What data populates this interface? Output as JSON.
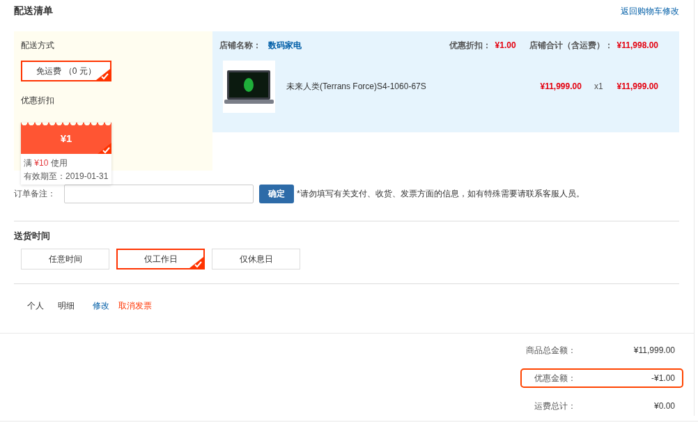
{
  "header": {
    "title": "配送清单",
    "back_link": "返回购物车修改"
  },
  "shipping": {
    "title": "配送方式",
    "options": [
      {
        "label": "免运费 （0 元）",
        "selected": true
      }
    ]
  },
  "discount": {
    "title": "优惠折扣",
    "coupons": [
      {
        "amount": "¥1",
        "condition": "满 **¥10** 使用",
        "expiry": "有效期至：2019-01-31",
        "selected": true
      }
    ]
  },
  "store": {
    "name_label": "店铺名称：",
    "name": "数码家电",
    "discount_label": "优惠折扣：",
    "discount": "¥1.00",
    "total_label": "店铺合计（含运费）：",
    "total": "¥11,998.00",
    "items": [
      {
        "name": "未来人类(Terrans Force)S4-1060-67S",
        "price": "¥11,999.00",
        "quantity": "x1",
        "subtotal": "¥11,999.00"
      }
    ]
  },
  "remark": {
    "label": "订单备注：",
    "button": "确定",
    "note": "*请勿填写有关支付、收货、发票方面的信息，如有特殊需要请联系客服人员。"
  },
  "delivery_time": {
    "title": "送货时间",
    "options": [
      {
        "label": "任意时间",
        "selected": false
      },
      {
        "label": "仅工作日",
        "selected": true
      },
      {
        "label": "仅休息日",
        "selected": false
      }
    ]
  },
  "invoice": {
    "type": "个人",
    "content": "明细",
    "edit": "修改",
    "cancel": "取消发票"
  },
  "summary": [
    {
      "label": "商品总金额：",
      "value": "¥11,999.00",
      "highlighted": false
    },
    {
      "label": "优惠金额：",
      "value": "-¥1.00",
      "highlighted": true
    },
    {
      "label": "运费总计：",
      "value": "¥0.00",
      "highlighted": false
    }
  ]
}
